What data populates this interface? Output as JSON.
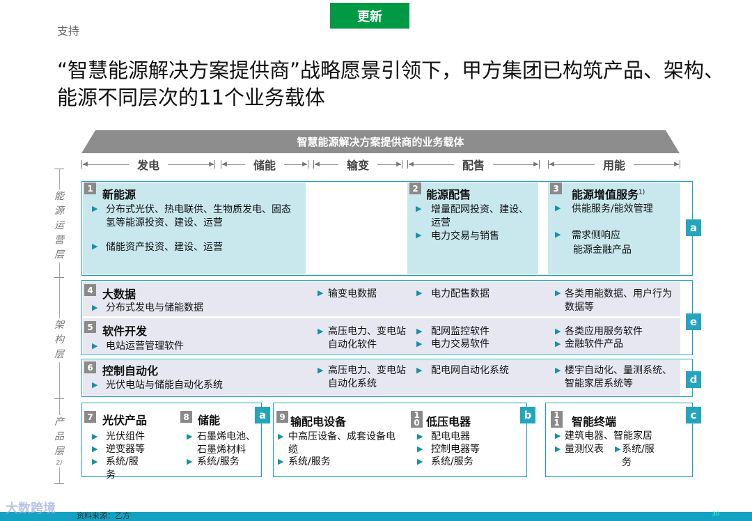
{
  "header": {
    "support_label": "支持",
    "update_badge": "更新",
    "title": "“智慧能源解决方案提供商”战略愿景引领下，甲方集团已构筑产品、架构、能源不同层次的11个业务载体"
  },
  "banner": "智慧能源解决方案提供商的业务载体",
  "segments": [
    "发电",
    "储能",
    "输变",
    "配售",
    "用能"
  ],
  "layers": {
    "operation": [
      "能",
      "源",
      "运",
      "营",
      "层"
    ],
    "architecture": [
      "架",
      "构",
      "层"
    ],
    "product": [
      "产",
      "品",
      "层",
      "2)"
    ]
  },
  "operation_layer": {
    "tag": "a",
    "c1": {
      "num": "1",
      "title": "新能源",
      "items": [
        "分布式光伏、热电联供、生物质发电、固态氢等能源投资、建设、运营",
        "储能资产投资、建设、运营"
      ]
    },
    "c2": {
      "num": "2",
      "title": "能源配售",
      "items": [
        "增量配网投资、建设、运营",
        "电力交易与销售"
      ]
    },
    "c3": {
      "num": "3",
      "title": "能源增值服务",
      "sup": "1)",
      "items": [
        "供能服务/能效管理",
        "需求侧响应",
        "能源金融产品"
      ]
    }
  },
  "arch_layer": {
    "tag_e": "e",
    "tag_d": "d",
    "big_data": {
      "num": "4",
      "title": "大数据",
      "gen": "分布式发电与储能数据",
      "trans": "输变电数据",
      "dist": "电力配售数据",
      "use": "各类用能数据、用户行为数据等"
    },
    "software": {
      "num": "5",
      "title": "软件开发",
      "gen": "电站运营管理软件",
      "trans": "高压电力、变电站自动化软件",
      "dist1": "配网监控软件",
      "dist2": "电力交易软件",
      "use1": "各类应用服务软件",
      "use2": "金融软件产品"
    },
    "control": {
      "num": "6",
      "title": "控制自动化",
      "gen": "光伏电站与储能自动化系统",
      "trans": "高压电力、变电站自动化系统",
      "dist": "配电网自动化系统",
      "use": "楼宇自动化、量测系统、智能家居系统等"
    }
  },
  "product_layer": {
    "pv": {
      "num": "7",
      "title": "光伏产品",
      "items": [
        "光伏组件",
        "逆变器等",
        "系统/服务"
      ]
    },
    "storage": {
      "num": "8",
      "title": "储能",
      "tag": "a",
      "items": [
        "石墨烯电池、石墨烯材料",
        "系统/服务"
      ]
    },
    "dist_equip": {
      "num": "9",
      "title": "输配电设备",
      "items": [
        "中高压设备、成套设备电缆",
        "系统/服务"
      ]
    },
    "lv": {
      "num": "1",
      "num2": "0",
      "title": "低压电器",
      "tag": "b",
      "items": [
        "配电电器",
        "控制电器等",
        "系统/服务"
      ]
    },
    "terminal": {
      "num": "1",
      "num2": "1",
      "title": "智能终端",
      "tag": "c",
      "items": [
        "建筑电器、智能家居",
        "量测仪表",
        "系统/服务"
      ]
    }
  },
  "footer": {
    "source": "资料来源：乙方",
    "watermark": "大数跨境",
    "page": "30"
  },
  "colors": {
    "accent": "#1d9fb5",
    "badge": "#009a44",
    "teal_fill": "#c8e8ee",
    "lavender_fill": "#e6e7f1",
    "footer": "#14a2c2"
  }
}
